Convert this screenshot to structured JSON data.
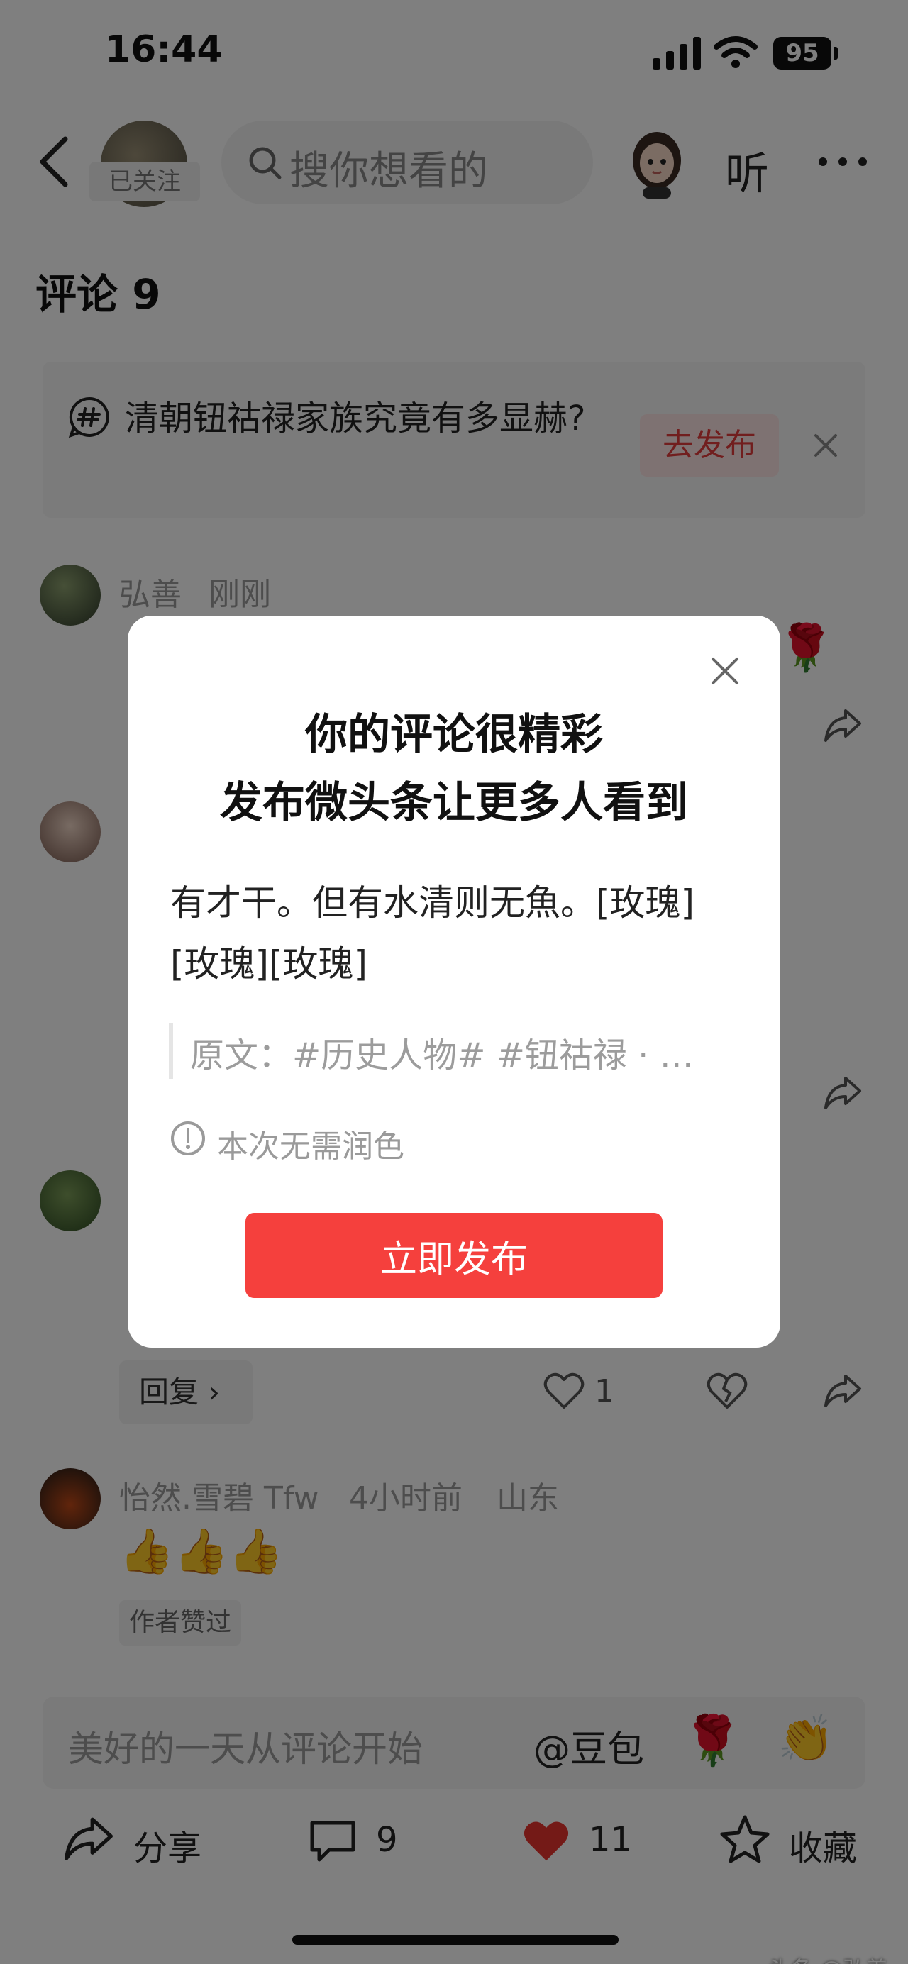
{
  "status_bar": {
    "time": "16:44",
    "battery": "95"
  },
  "header": {
    "followed_label": "已关注",
    "search_placeholder": "搜你想看的",
    "listen_label": "听"
  },
  "comments": {
    "title": "评论 9",
    "topic_card": {
      "text": "清朝钮祜禄家族究竟有多显赫?",
      "publish_label": "去发布"
    },
    "items": [
      {
        "author": "弘善",
        "time": "刚刚",
        "region": ""
      },
      {
        "author": "",
        "time": "",
        "region": ""
      },
      {
        "author": "",
        "time": "",
        "region": "",
        "reply_label": "回复",
        "likes": "1"
      },
      {
        "author": "怡然.雪碧 Tfw",
        "time": "4小时前",
        "region": "山东",
        "author_liked_label": "作者赞过"
      }
    ]
  },
  "input_bar": {
    "placeholder": "美好的一天从评论开始",
    "mention": "@豆包"
  },
  "bottom_bar": {
    "share_label": "分享",
    "comment_count": "9",
    "like_count": "11",
    "favorite_label": "收藏"
  },
  "watermark": "头条 @弘善",
  "modal": {
    "title_line1": "你的评论很精彩",
    "title_line2": "发布微头条让更多人看到",
    "content": "有才干。但有水清则无魚。[玫瑰][玫瑰][玫瑰]",
    "quote": "原文：#历史人物# #钮祜禄 · …",
    "polish_note": "本次无需润色",
    "publish_button": "立即发布"
  },
  "colors": {
    "accent_red": "#f5403d",
    "publish_chip_bg": "#fce4e4",
    "heart_red": "#e8352f"
  },
  "icons": [
    "signal-icon",
    "wifi-icon",
    "back-icon",
    "search-icon",
    "more-icon",
    "hashtag-icon",
    "close-icon",
    "share-icon",
    "heart-icon",
    "broken-heart-icon",
    "comment-icon",
    "star-icon",
    "info-icon",
    "rose-emoji",
    "thumbs-up-emoji",
    "clap-emoji"
  ]
}
